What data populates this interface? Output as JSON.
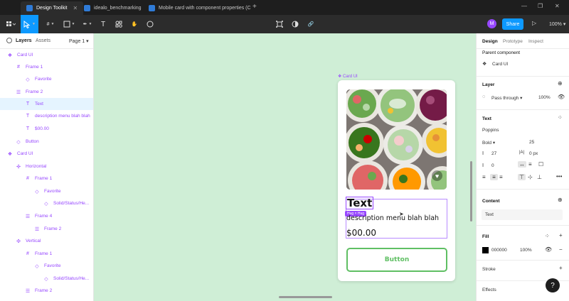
{
  "browser": {
    "tabs": [
      {
        "title": "Design Toolkit",
        "active": true
      },
      {
        "title": "idealo_benchmarking",
        "active": false
      },
      {
        "title": "Mobile card with component properties (C",
        "active": false
      }
    ],
    "new_tab": "+",
    "window_controls": [
      "—",
      "❐",
      "✕"
    ]
  },
  "toolbar": {
    "avatar_letter": "M",
    "share_label": "Share",
    "play_icon": "▷",
    "zoom": "100%"
  },
  "layers_panel": {
    "tab_layers": "Layers",
    "tab_assets": "Assets",
    "page": "Page 1",
    "items": [
      {
        "label": "Card UI",
        "icon": "component-icon"
      },
      {
        "label": "Frame 1",
        "icon": "frame-icon"
      },
      {
        "label": "Favorite",
        "icon": "instance-icon"
      },
      {
        "label": "Frame 2",
        "icon": "autolayout-icon"
      },
      {
        "label": "Text",
        "icon": "text-icon"
      },
      {
        "label": "description menu blah blah",
        "icon": "text-icon"
      },
      {
        "label": "$00.00",
        "icon": "text-icon"
      },
      {
        "label": "Button",
        "icon": "instance-icon"
      },
      {
        "label": "Card UI",
        "icon": "component-icon"
      },
      {
        "label": "Horizontal",
        "icon": "variant-icon"
      },
      {
        "label": "Frame 1",
        "icon": "frame-icon"
      },
      {
        "label": "Favorite",
        "icon": "instance-icon"
      },
      {
        "label": "Solid/Status/He...",
        "icon": "instance-icon"
      },
      {
        "label": "Frame 4",
        "icon": "autolayout-icon"
      },
      {
        "label": "Frame 2",
        "icon": "autolayout-icon"
      },
      {
        "label": "Vertical",
        "icon": "variant-icon"
      },
      {
        "label": "Frame 1",
        "icon": "frame-icon"
      },
      {
        "label": "Favorite",
        "icon": "instance-icon"
      },
      {
        "label": "Solid/Status/He...",
        "icon": "instance-icon"
      },
      {
        "label": "Frame 2",
        "icon": "autolayout-icon"
      }
    ]
  },
  "canvas": {
    "frame_label": "Card UI",
    "card_title": "Text",
    "hug_badge": "Hug × Hug",
    "card_description": "description menu blah blah",
    "card_price": "$00.00",
    "card_button": "Button"
  },
  "properties": {
    "tabs": [
      "Design",
      "Prototype",
      "Inspect"
    ],
    "parent_component_heading": "Parent component",
    "parent_component": "Card UI",
    "layer_heading": "Layer",
    "blend_mode": "Pass through",
    "layer_opacity": "100%",
    "text_heading": "Text",
    "font_family": "Poppins",
    "font_weight": "Bold",
    "font_size": "25",
    "line_height": "27",
    "letter_spacing": "0 px",
    "paragraph_spacing": "0",
    "content_heading": "Content",
    "content_value": "Text",
    "fill_heading": "Fill",
    "fill_hex": "000000",
    "fill_opacity": "100%",
    "stroke_heading": "Stroke",
    "effects_heading": "Effects"
  },
  "help": "?"
}
